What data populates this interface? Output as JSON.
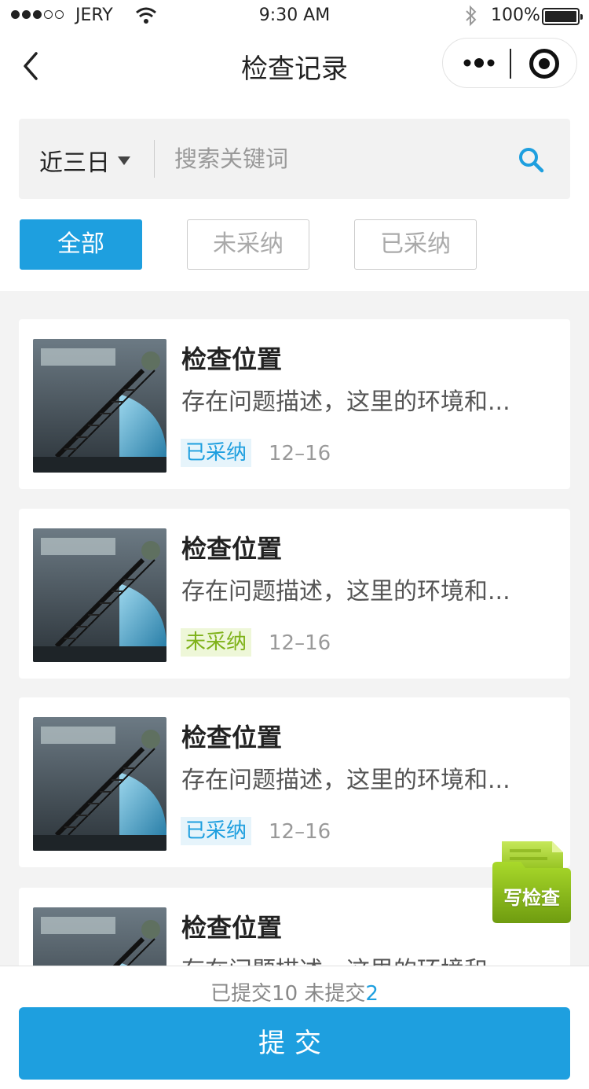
{
  "status_bar": {
    "carrier": "JERY",
    "time": "9:30 AM",
    "battery": "100%"
  },
  "nav": {
    "title": "检查记录"
  },
  "search": {
    "date_filter": "近三日",
    "placeholder": "搜索关键词"
  },
  "tabs": [
    {
      "label": "全部",
      "active": true
    },
    {
      "label": "未采纳",
      "active": false
    },
    {
      "label": "已采纳",
      "active": false
    }
  ],
  "records": [
    {
      "title": "检查位置",
      "desc": "存在问题描述，这里的环境和...",
      "status": "已采纳",
      "date": "12–16"
    },
    {
      "title": "检查位置",
      "desc": "存在问题描述，这里的环境和...",
      "status": "未采纳",
      "date": "12–16"
    },
    {
      "title": "检查位置",
      "desc": "存在问题描述，这里的环境和...",
      "status": "已采纳",
      "date": "12–16"
    },
    {
      "title": "检查位置",
      "desc": "存在问题描述，这里的环境和..."
    }
  ],
  "fab": {
    "label": "写检查"
  },
  "summary": {
    "submitted_label": "已提交",
    "submitted_count": "10",
    "pending_label": "未提交",
    "pending_count": "2"
  },
  "submit_label": "提交",
  "colors": {
    "accent": "#1e9fdf",
    "adopted_bg": "#e6f4fb",
    "not_adopted": "#7fb21a",
    "fab_green": "#8dbf1c"
  }
}
